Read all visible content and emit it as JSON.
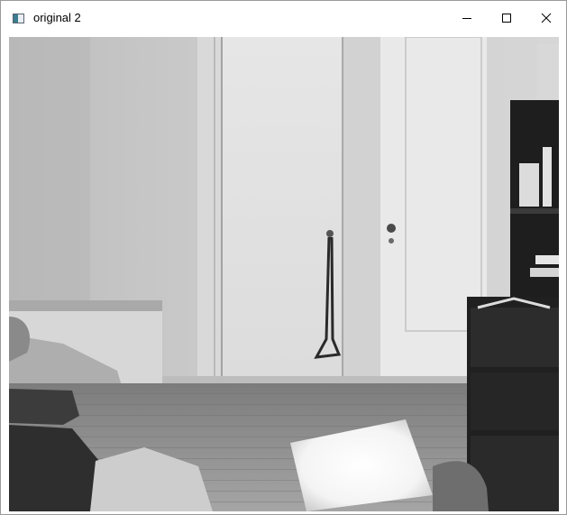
{
  "window": {
    "title": "original 2",
    "icon": "app-window-icon",
    "controls": {
      "minimize": "minimize-icon",
      "maximize": "maximize-icon",
      "close": "close-icon"
    }
  },
  "image": {
    "description_icon": "webcam-frame-grayscale"
  }
}
